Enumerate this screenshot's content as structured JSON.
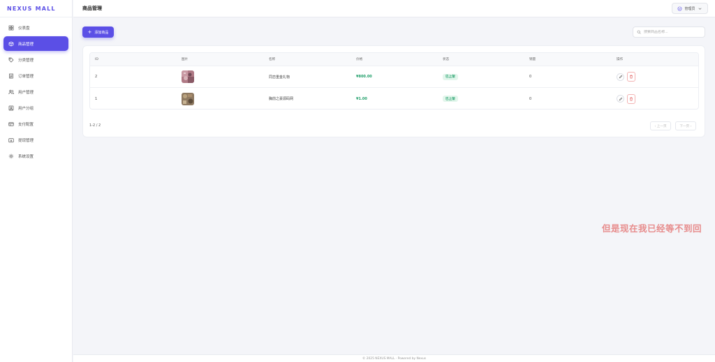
{
  "brand": "NEXUS MALL",
  "sidebar": {
    "items": [
      {
        "label": "仪表盘",
        "icon": "dashboard-icon"
      },
      {
        "label": "商品管理",
        "icon": "box-icon"
      },
      {
        "label": "分类管理",
        "icon": "tag-icon"
      },
      {
        "label": "订单管理",
        "icon": "order-icon"
      },
      {
        "label": "用户管理",
        "icon": "users-icon"
      },
      {
        "label": "用户分组",
        "icon": "user-group-icon"
      },
      {
        "label": "支付配置",
        "icon": "card-icon"
      },
      {
        "label": "提现管理",
        "icon": "wallet-icon"
      },
      {
        "label": "系统设置",
        "icon": "gear-icon"
      }
    ],
    "active_index": 1
  },
  "header": {
    "title": "商品管理",
    "user_label": "管理员"
  },
  "toolbar": {
    "add_label": "添加商品",
    "search_placeholder": "搜索商品名称..."
  },
  "table": {
    "columns": [
      "ID",
      "图片",
      "名称",
      "价格",
      "状态",
      "销量",
      "操作"
    ],
    "rows": [
      {
        "id": "2",
        "name": "同恋重金礼物",
        "price": "¥800.00",
        "status": "已上架",
        "sales": "0"
      },
      {
        "id": "1",
        "name": "胸前之豪源码网",
        "price": "¥1.00",
        "status": "已上架",
        "sales": "0"
      }
    ]
  },
  "pagination": {
    "info": "1-2 / 2",
    "prev": "‹ 上一页",
    "next": "下一页 ›"
  },
  "overlay_text": "但是现在我已经等不到回",
  "footer": "© 2025 NEXUS MALL · Powered by Nexus",
  "colors": {
    "accent": "#5b4fe6",
    "success": "#22a06b",
    "danger": "#e05555"
  }
}
